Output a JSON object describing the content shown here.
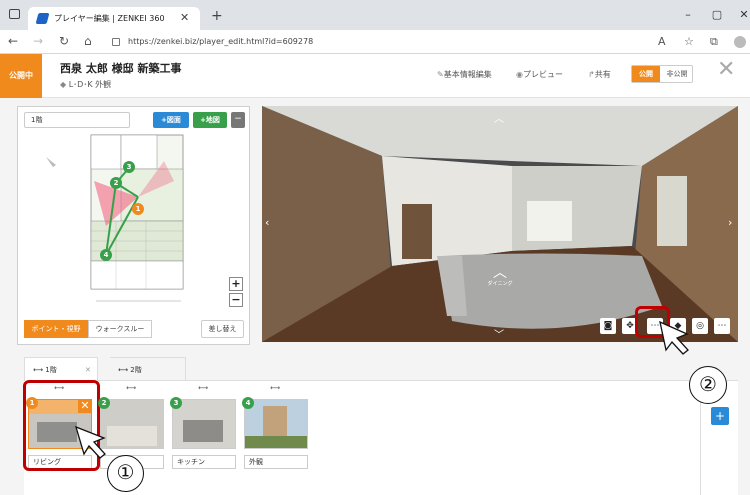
{
  "browser": {
    "tab_title": "プレイヤー編集 | ZENKEI 360",
    "url": "https://zenkei.biz/player_edit.html?id=609278"
  },
  "header": {
    "status_badge": "公開中",
    "title": "西泉 太郎 様邸 新築工事",
    "subtitle": "L･D･K 外観",
    "links": {
      "edit_info": "基本情報編集",
      "preview": "プレビュー",
      "share": "共有"
    },
    "toggle": {
      "public": "公開",
      "private": "非公開"
    }
  },
  "floor_plan": {
    "floor_name": "1階",
    "add_plan": "+図面",
    "add_map": "+地図",
    "points": [
      "1",
      "2",
      "3",
      "4"
    ],
    "tabs": {
      "point_view": "ポイント・視野",
      "walkthrough": "ウォークスルー"
    },
    "replace": "差し替え",
    "zoom_in": "+",
    "zoom_out": "−"
  },
  "viewer": {
    "hotspot_label": "ダイニング"
  },
  "scenes": {
    "tabs": [
      {
        "label": "1階"
      },
      {
        "label": "2階"
      }
    ],
    "items": [
      {
        "number": "1",
        "label": "リビング",
        "color": "#f08a1c"
      },
      {
        "number": "2",
        "label": "",
        "color": "#38a04a"
      },
      {
        "number": "3",
        "label": "キッチン",
        "color": "#38a04a"
      },
      {
        "number": "4",
        "label": "外観",
        "color": "#38a04a"
      }
    ],
    "add": "+"
  },
  "callouts": {
    "one": "①",
    "two": "②"
  },
  "colors": {
    "accent": "#f08a1c",
    "blue": "#2a8ad6",
    "green": "#38a04a",
    "highlight": "#c00000"
  }
}
